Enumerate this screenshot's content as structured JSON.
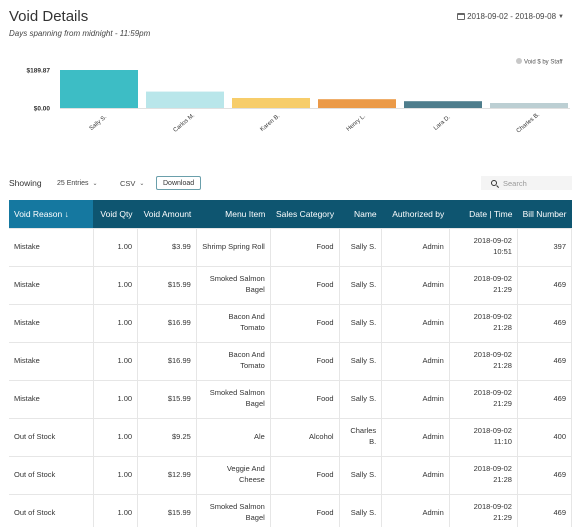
{
  "header": {
    "title": "Void Details",
    "subtitle": "Days spanning from midnight - 11:59pm",
    "date_range": "2018-09-02 - 2018-09-08"
  },
  "chart_data": {
    "type": "bar",
    "categories": [
      "Sally S.",
      "Carlos M.",
      "Karen B.",
      "Henry L.",
      "Lara D.",
      "Charles B."
    ],
    "series": [
      {
        "name": "Void $ by Staff",
        "values": [
          189.87,
          82,
          50,
          44,
          34,
          25
        ]
      }
    ],
    "colors": [
      "#3dbdc5",
      "#b9e6ea",
      "#f7cd6a",
      "#eb9a48",
      "#4e7d8c",
      "#bccfd3"
    ],
    "ytick_labels": [
      "$189.87",
      "$0.00"
    ],
    "ylim": [
      0,
      189.87
    ],
    "legend": "Void $ by Staff",
    "legend_position": "top-right",
    "legend_color": "#c8c8c8",
    "grid": false
  },
  "toolbar": {
    "showing_label": "Showing",
    "entries_value": "25 Entries",
    "export_value": "CSV",
    "download_label": "Download",
    "search_placeholder": "Search"
  },
  "table": {
    "columns": [
      "Void Reason ↓",
      "Void Qty",
      "Void Amount",
      "Menu Item",
      "Sales Category",
      "Name",
      "Authorized by",
      "Date | Time",
      "Bill Number"
    ],
    "rows": [
      [
        "Mistake",
        "1.00",
        "$3.99",
        "Shrimp Spring Roll",
        "Food",
        "Sally S.",
        "Admin",
        "2018-09-02\n10:51",
        "397"
      ],
      [
        "Mistake",
        "1.00",
        "$15.99",
        "Smoked Salmon\nBagel",
        "Food",
        "Sally S.",
        "Admin",
        "2018-09-02\n21:29",
        "469"
      ],
      [
        "Mistake",
        "1.00",
        "$16.99",
        "Bacon And\nTomato",
        "Food",
        "Sally S.",
        "Admin",
        "2018-09-02\n21:28",
        "469"
      ],
      [
        "Mistake",
        "1.00",
        "$16.99",
        "Bacon And\nTomato",
        "Food",
        "Sally S.",
        "Admin",
        "2018-09-02\n21:28",
        "469"
      ],
      [
        "Mistake",
        "1.00",
        "$15.99",
        "Smoked Salmon\nBagel",
        "Food",
        "Sally S.",
        "Admin",
        "2018-09-02\n21:29",
        "469"
      ],
      [
        "Out of Stock",
        "1.00",
        "$9.25",
        "Ale",
        "Alcohol",
        "Charles\nB.",
        "Admin",
        "2018-09-02\n11:10",
        "400"
      ],
      [
        "Out of Stock",
        "1.00",
        "$12.99",
        "Veggie And\nCheese",
        "Food",
        "Sally S.",
        "Admin",
        "2018-09-02\n21:28",
        "469"
      ],
      [
        "Out of Stock",
        "1.00",
        "$15.99",
        "Smoked Salmon\nBagel",
        "Food",
        "Sally S.",
        "Admin",
        "2018-09-02\n21:29",
        "469"
      ]
    ]
  }
}
